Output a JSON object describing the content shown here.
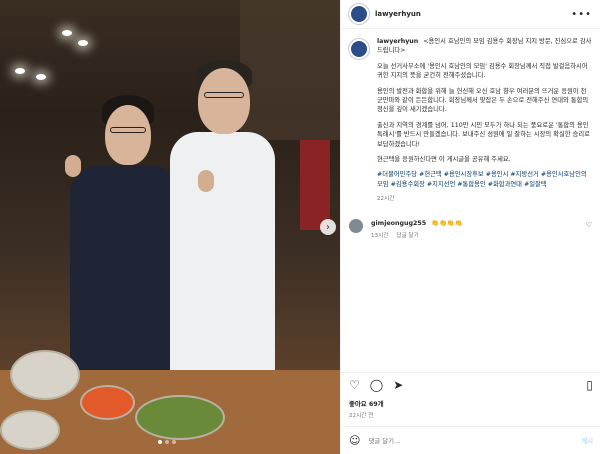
{
  "post": {
    "username": "lawyerhyun",
    "caption": {
      "intro": "<용인시 호남인의 모임 김용수 회장님 지지 방문, 진심으로 감사드립니다>",
      "paragraphs": [
        "오늘 선거사무소에 '용인시 호남인의 모임' 김용수 회장님께서 직접 발걸음하시어 귀한 지지의 뜻을 굳건히 전해주셨습니다.",
        "용인의 발전과 화합을 위해 늘 헌신해 오신 호남 향우 여러분의 뜨거운 응원이 천군만마와 같이 든든합니다. 회장님께서 맞잡은 두 손으로 전해주신 연대와 통합의 정신을 깊이 새기겠습니다.",
        "출신과 지역의 경계를 넘어, 110만 시민 모두가 하나 되는 풍요로운 '통합의 용인특례시'를 반드시 만들겠습니다. 보내주신 성원에 일 잘하는 시장의 확실한 승리로 보답하겠습니다!",
        "현근택을 응원하신다면 이 게시글을 공유해 주세요."
      ],
      "hashtags": "#더불어민주당 #현근택 #용인시장후보 #용인시 #지방선거 #용인시호남인의모임 #김용수회장 #지지선언 #통합용인 #화합과연대 #일잘택",
      "time": "22시간"
    },
    "comment": {
      "username": "gimjeongug255",
      "text": "👏👏👏👏",
      "time": "13시간",
      "reply_label": "답글 달기"
    },
    "likes_label": "좋아요 69개",
    "posted_time": "22시간 전",
    "comment_placeholder": "댓글 달기...",
    "post_button_label": "게시"
  },
  "icons": {
    "more": "more-options-icon",
    "like": "heart-icon",
    "comment": "comment-icon",
    "share": "share-icon",
    "save": "bookmark-icon",
    "emoji": "emoji-icon",
    "next": "chevron-right-icon"
  },
  "colors": {
    "hashtag": "#00376b",
    "muted": "#737373",
    "post_button": "#b3dbff"
  },
  "carousel": {
    "slide_count": 3,
    "active_slide": 1
  }
}
